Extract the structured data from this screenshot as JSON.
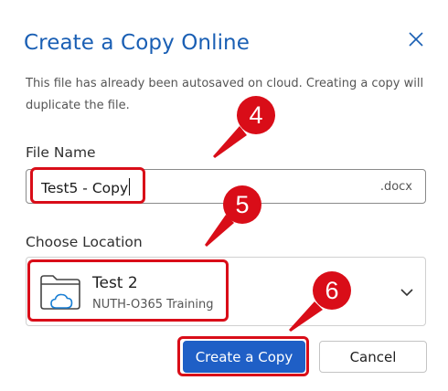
{
  "dialog": {
    "title": "Create a Copy Online",
    "description": "This file has already been autosaved on cloud. Creating a copy will duplicate the file."
  },
  "file_name": {
    "label": "File Name",
    "value": "Test5 - Copy",
    "extension": ".docx"
  },
  "location": {
    "label": "Choose Location",
    "name": "Test 2",
    "subtitle": "NUTH-O365 Training"
  },
  "buttons": {
    "create": "Create a Copy",
    "cancel": "Cancel"
  },
  "annotations": {
    "step1": "4",
    "step2": "5",
    "step3": "6",
    "color": "#d90d18"
  },
  "colors": {
    "title": "#1a5fb4",
    "primary": "#1f5fc6"
  },
  "icons": {
    "close": "close-icon",
    "folder": "folder-cloud-icon",
    "dropdown": "chevron-down-icon"
  }
}
